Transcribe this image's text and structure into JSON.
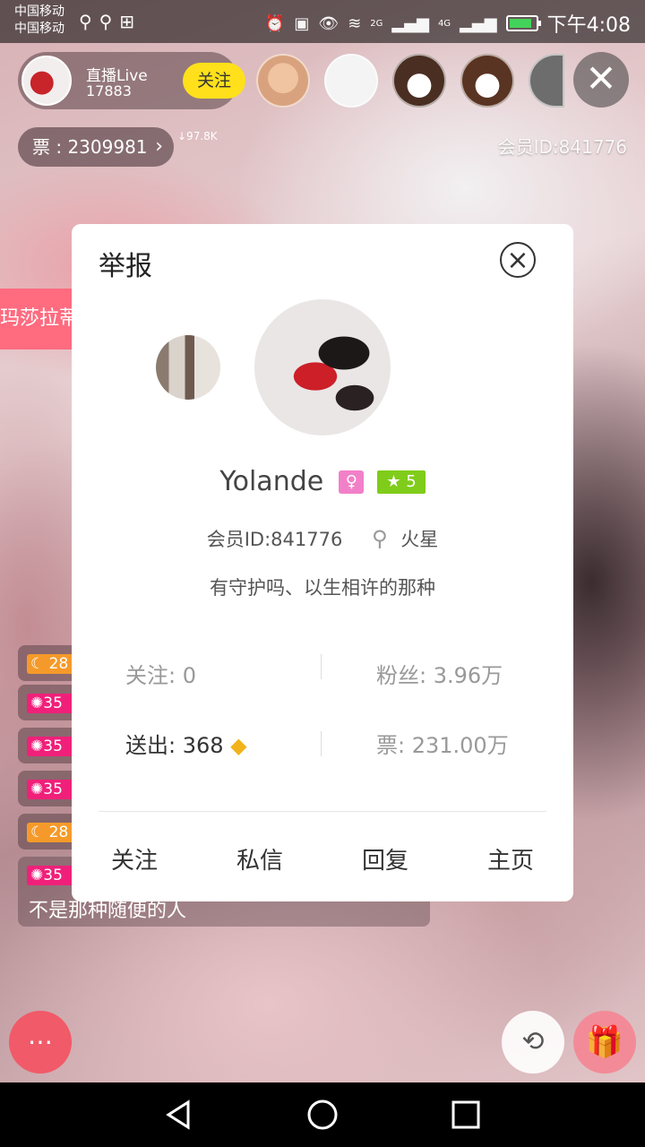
{
  "status_bar": {
    "carrier_1": "中国移动",
    "carrier_2": "中国移动",
    "network_1": "2G",
    "network_2": "4G",
    "time": "下午4:08",
    "battery_color": "#44d35a"
  },
  "live": {
    "host_label": "直播Live",
    "viewer_count": "17883",
    "follow_label": "关注",
    "tickets_label": "票 : 2309981",
    "trend": "↓97.8K",
    "member_id": "会员ID:841776",
    "side_banner": "玛莎拉蒂",
    "chat_badges": [
      "28",
      "35",
      "35",
      "35",
      "28",
      "35"
    ],
    "chat_message": "不是那种随便的人"
  },
  "dialog": {
    "title": "举报",
    "user_name": "Yolande",
    "level": "5",
    "member_id": "会员ID:841776",
    "location": "火星",
    "signature": "有守护吗、以生相许的那种",
    "following": "关注: 0",
    "fans": "粉丝: 3.96万",
    "sent": "送出: 368",
    "tickets": "票: 231.00万",
    "actions": {
      "follow": "关注",
      "message": "私信",
      "reply": "回复",
      "homepage": "主页"
    }
  },
  "colors": {
    "follow_yellow": "#ffe01b",
    "chat_pink": "#f15a68",
    "level_green": "#80cc1a",
    "gender_pink": "#f280c8",
    "banner_pink": "#ff6b7f"
  }
}
